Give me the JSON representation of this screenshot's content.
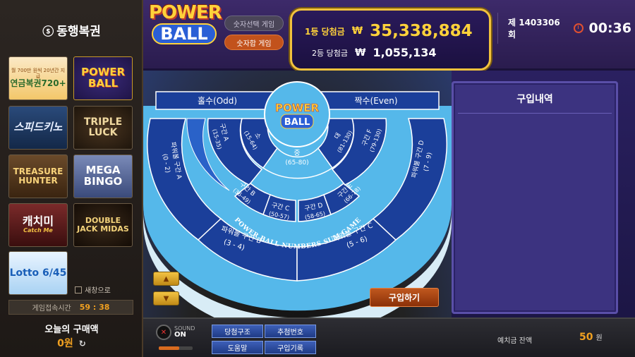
{
  "sidebar": {
    "logo": "동행복권",
    "games": [
      {
        "name": "연금복권720+",
        "sub": "월 700만 원씩 20년간 지급"
      },
      {
        "name": "POWER BALL"
      },
      {
        "name": "스피드키노"
      },
      {
        "name": "TRIPLE LUCK"
      },
      {
        "name": "TREASURE HUNTER"
      },
      {
        "name": "MEGA BINGO"
      },
      {
        "name": "캐치미",
        "sub": "Catch Me"
      },
      {
        "name": "DOUBLE JACK MIDAS"
      },
      {
        "name": "Lotto 6/45"
      }
    ],
    "popup_label": "새창으로",
    "connect_label": "게임접속시간",
    "connect_time": "59 : 38",
    "today_label": "오늘의 구매액",
    "today_amount": "0원"
  },
  "header": {
    "logo_line1": "POWER",
    "logo_line2": "BALL",
    "mode_select": "숫자선택 게임",
    "mode_sum": "숫자합 게임",
    "prize1_label": "1등 당첨금",
    "prize1_amount": "35,338,884",
    "prize2_label": "2등 당첨금",
    "prize2_amount": "1,055,134",
    "currency": "₩",
    "round": "제 1403306회",
    "time": "00:36"
  },
  "board": {
    "odd": "홀수(Odd)",
    "even": "짝수(Even)",
    "center_logo1": "POWER",
    "center_logo2": "BALL",
    "middle": "중",
    "middle_range": "(65-80)",
    "small": "소",
    "small_range": "(15-64)",
    "large": "대",
    "large_range": "(81-130)",
    "zone_a": "구간 A",
    "zone_a_range": "(15-35)",
    "zone_b": "구간 B",
    "zone_b_range": "(36-49)",
    "zone_c": "구간 C",
    "zone_c_range": "(50-57)",
    "zone_d": "구간 D",
    "zone_d_range": "(58-65)",
    "zone_e": "구간 E",
    "zone_e_range": "(66-78)",
    "zone_f": "구간 F",
    "zone_f_range": "(79-130)",
    "pb_a": "파워볼 구간 A",
    "pb_a_range": "(0 - 2)",
    "pb_b": "파워볼 구간 B",
    "pb_b_range": "(3 - 4)",
    "pb_c": "파워볼 구간 C",
    "pb_c_range": "(5 - 6)",
    "pb_d": "파워볼 구간 D",
    "pb_d_range": "(7 - 9)",
    "arc_text": "POWER BALL NUMBERS SUM GAME",
    "buy": "구입하기"
  },
  "panel": {
    "title": "구입내역"
  },
  "footer": {
    "sound_label": "SOUND",
    "sound_state": "ON",
    "btn1": "당첨구조",
    "btn2": "추첨번호",
    "btn3": "도움말",
    "btn4": "구입기록",
    "deposit_label": "예치금 잔액",
    "deposit_amount": "50",
    "deposit_unit": "원"
  }
}
